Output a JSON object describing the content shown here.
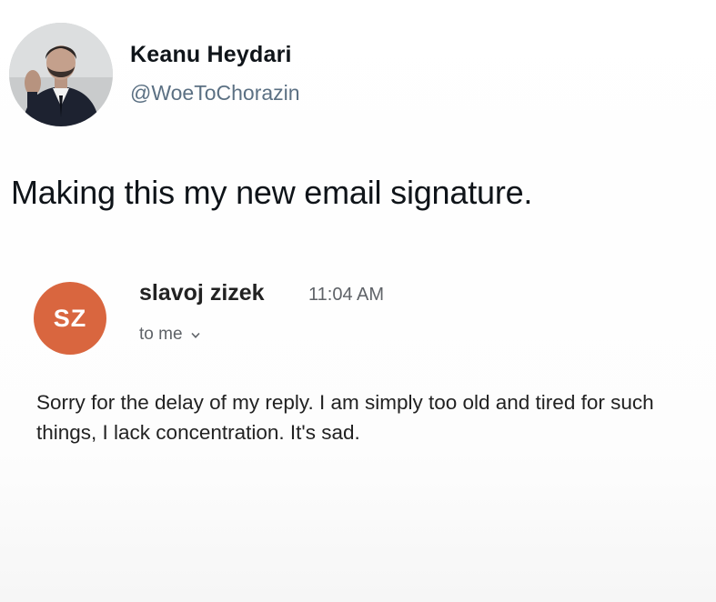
{
  "tweet": {
    "author_name": "Keanu Heydari",
    "author_handle": "@WoeToChorazin",
    "text": "Making this my new email signature."
  },
  "email": {
    "sender_initials": "SZ",
    "sender_name": "slavoj zizek",
    "time": "11:04 AM",
    "recipient": "to me",
    "body": "Sorry for the delay of my reply. I am simply too old and tired for such things, I lack concentration. It's sad.",
    "avatar_color": "#d9663f"
  },
  "icons": {
    "recipient_toggle": "chevron-down-icon",
    "profile_photo": "avatar"
  }
}
